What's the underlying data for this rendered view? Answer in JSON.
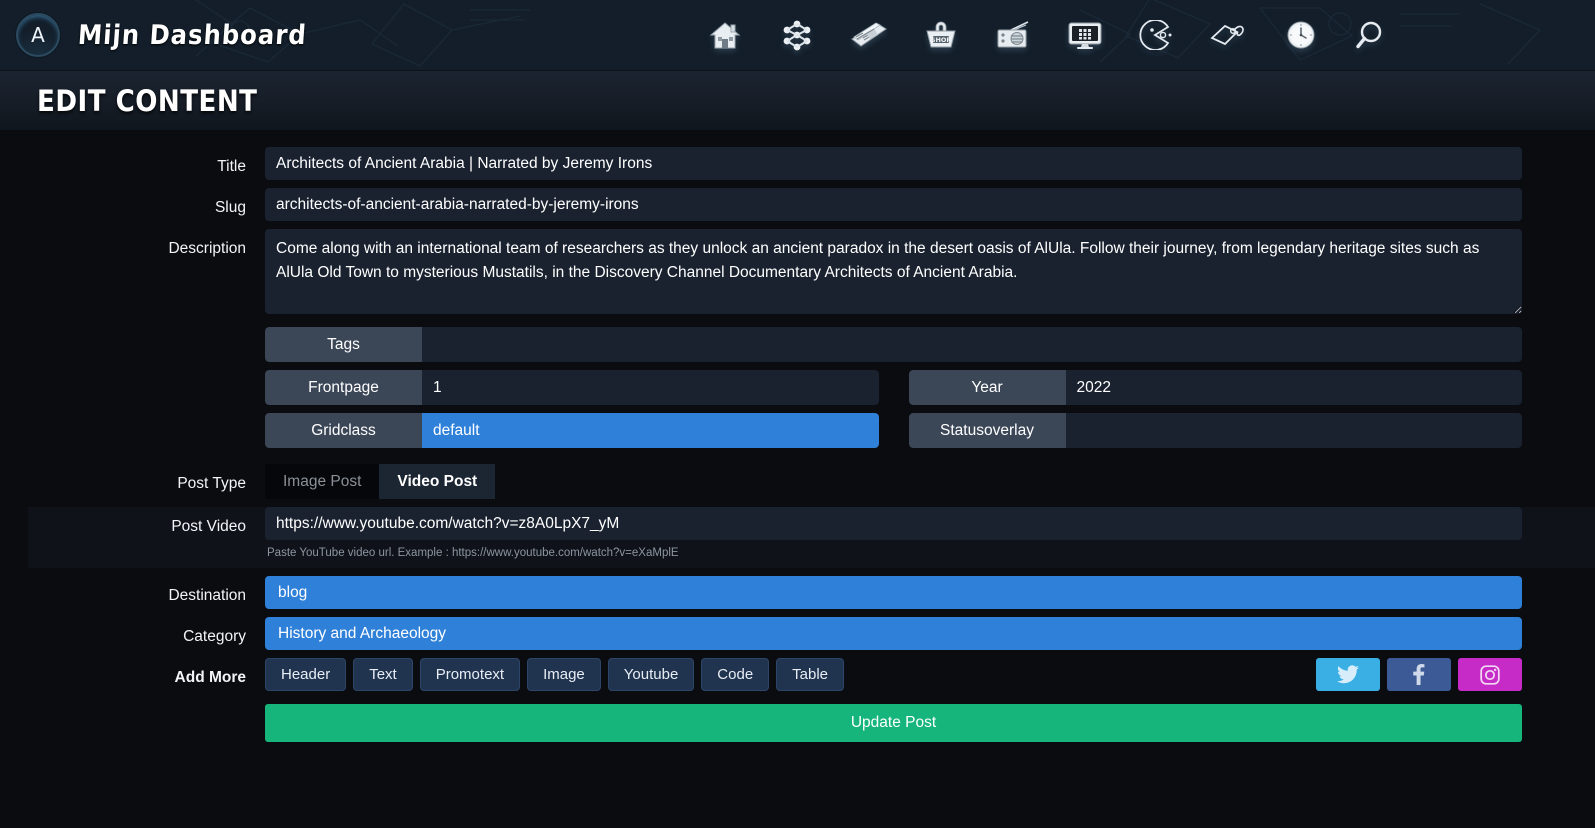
{
  "header": {
    "brand_initial": "A",
    "brand_title": "Mijn Dashboard",
    "nav": [
      {
        "name": "home-icon",
        "label": "Home"
      },
      {
        "name": "network-icon",
        "label": "Network"
      },
      {
        "name": "newspaper-icon",
        "label": "News"
      },
      {
        "name": "shop-basket-icon",
        "label": "Shop"
      },
      {
        "name": "radio-icon",
        "label": "Radio"
      },
      {
        "name": "monitor-icon",
        "label": "Screen"
      },
      {
        "name": "pacman-icon",
        "label": "Games"
      },
      {
        "name": "price-tag-icon",
        "label": "Tags"
      },
      {
        "name": "clock-icon",
        "label": "Time"
      },
      {
        "name": "search-icon",
        "label": "Search"
      }
    ]
  },
  "page": {
    "title": "EDIT CONTENT"
  },
  "form": {
    "title": {
      "label": "Title",
      "value": "Architects of Ancient Arabia | Narrated by Jeremy Irons",
      "placeholder": "Title"
    },
    "slug": {
      "label": "Slug",
      "value": "architects-of-ancient-arabia-narrated-by-jeremy-irons",
      "placeholder": "Slug"
    },
    "description": {
      "label": "Description",
      "value": "Come along with an international team of researchers as they unlock an ancient paradox in the desert oasis of AlUla. Follow their journey, from legendary heritage sites such as AlUla Old Town to mysterious Mustatils, in the Discovery Channel Documentary Architects of Ancient Arabia.",
      "placeholder": "Description"
    },
    "tags": {
      "label": "Tags",
      "value": "",
      "placeholder": ""
    },
    "frontpage": {
      "label": "Frontpage",
      "value": "1",
      "placeholder": ""
    },
    "year": {
      "label": "Year",
      "value": "2022",
      "placeholder": ""
    },
    "gridclass": {
      "label": "Gridclass",
      "value": "default",
      "placeholder": ""
    },
    "statusoverlay": {
      "label": "Statusoverlay",
      "value": "",
      "placeholder": ""
    },
    "post_type": {
      "label": "Post Type",
      "tabs": [
        {
          "label": "Image Post",
          "active": false
        },
        {
          "label": "Video Post",
          "active": true
        }
      ]
    },
    "post_video": {
      "label": "Post Video",
      "value": "https://www.youtube.com/watch?v=z8A0LpX7_yM",
      "placeholder": "",
      "helper": "Paste YouTube video url. Example : https://www.youtube.com/watch?v=eXaMplE"
    },
    "destination": {
      "label": "Destination",
      "value": "blog"
    },
    "category": {
      "label": "Category",
      "value": "History and Archaeology"
    },
    "add_more": {
      "label": "Add More",
      "buttons": [
        {
          "label": "Header"
        },
        {
          "label": "Text"
        },
        {
          "label": "Promotext"
        },
        {
          "label": "Image"
        },
        {
          "label": "Youtube"
        },
        {
          "label": "Code"
        },
        {
          "label": "Table"
        }
      ]
    },
    "socials": [
      {
        "name": "twitter-icon",
        "label": "Twitter",
        "color": "#3aafe4"
      },
      {
        "name": "facebook-icon",
        "label": "Facebook",
        "color": "#3b5a96"
      },
      {
        "name": "instagram-icon",
        "label": "Instagram",
        "color": "#c62bc8"
      }
    ],
    "submit": {
      "label": "Update Post"
    }
  },
  "colors": {
    "accent_blue": "#2f80d8",
    "submit_green": "#15b57c",
    "header_bg": "#131e2a",
    "field_bg": "#1a2230",
    "prefix_bg": "#3b4657"
  }
}
